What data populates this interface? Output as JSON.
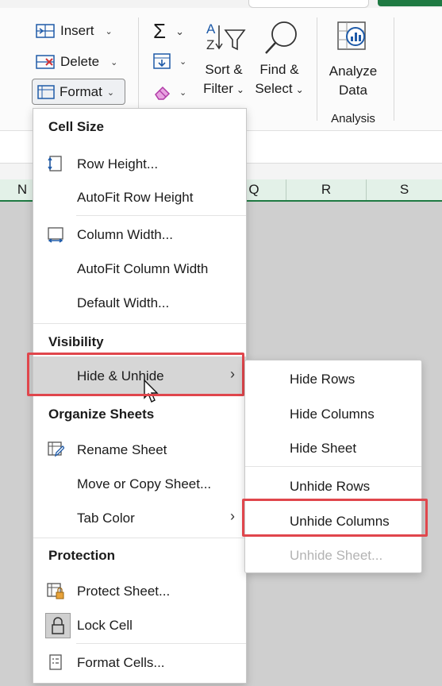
{
  "ribbon": {
    "insert": "Insert",
    "delete": "Delete",
    "format": "Format",
    "sum_caret": "⌄",
    "sort_filter": [
      "Sort &",
      "Filter"
    ],
    "find_select": [
      "Find &",
      "Select"
    ],
    "analyze": [
      "Analyze",
      "Data"
    ],
    "analysis_group": "Analysis"
  },
  "columns": [
    "N",
    "Q",
    "R",
    "S"
  ],
  "menu": {
    "cell_size": "Cell Size",
    "row_height": "Row Height...",
    "autofit_row": "AutoFit Row Height",
    "column_width": "Column Width...",
    "autofit_col": "AutoFit Column Width",
    "default_width": "Default Width...",
    "visibility": "Visibility",
    "hide_unhide": "Hide & Unhide",
    "organize": "Organize Sheets",
    "rename": "Rename Sheet",
    "move_copy": "Move or Copy Sheet...",
    "tab_color": "Tab Color",
    "protection": "Protection",
    "protect": "Protect Sheet...",
    "lock": "Lock Cell",
    "format_cells": "Format Cells..."
  },
  "submenu": {
    "hide_rows": "Hide Rows",
    "hide_columns": "Hide Columns",
    "hide_sheet": "Hide Sheet",
    "unhide_rows": "Unhide Rows",
    "unhide_columns": "Unhide Columns",
    "unhide_sheet": "Unhide Sheet..."
  },
  "colors": {
    "highlight_box": "#e0464c",
    "excel_green": "#1f7a43"
  }
}
